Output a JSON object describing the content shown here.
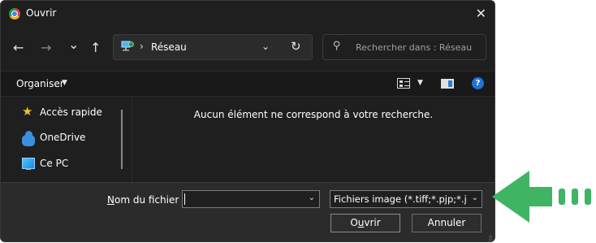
{
  "window": {
    "title": "Ouvrir",
    "close_glyph": "✕"
  },
  "nav": {
    "back_glyph": "←",
    "forward_glyph": "→",
    "recent_glyph": "⌄",
    "up_glyph": "↑",
    "address": {
      "separator": "›",
      "location": "Réseau",
      "dropdown_glyph": "⌄",
      "refresh_glyph": "↻"
    },
    "search": {
      "placeholder": "Rechercher dans : Réseau",
      "glyph": "⚲"
    }
  },
  "toolbar": {
    "organize_label": "Organiser",
    "organize_caret": "▼",
    "view_caret": "▼",
    "help_glyph": "?"
  },
  "sidebar": {
    "items": [
      {
        "label": "Accès rapide",
        "icon": "star-icon",
        "glyph": "★"
      },
      {
        "label": "OneDrive",
        "icon": "cloud-icon"
      },
      {
        "label": "Ce PC",
        "icon": "computer-icon"
      }
    ]
  },
  "content": {
    "empty_message": "Aucun élément ne correspond à votre recherche."
  },
  "footer": {
    "filename_label": "Nom du fichier :",
    "filename_value": "",
    "dropdown_glyph": "⌄",
    "filter_value": "Fichiers image (*.tiff;*.pjp;*.jfif;*",
    "open_button": "Ouvrir",
    "cancel_button": "Annuler",
    "grip_glyph": "⣿"
  },
  "colors": {
    "dialog_bg": "#1f1f1f",
    "footer_bg": "#2b2b2b",
    "accent_arrow": "#3fb463",
    "help_blue": "#1f73d6"
  }
}
